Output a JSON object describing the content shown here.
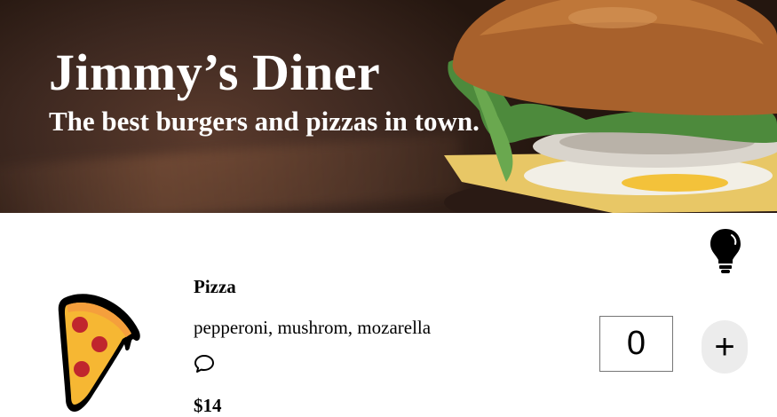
{
  "header": {
    "title": "Jimmy’s Diner",
    "subtitle": "The best burgers and pizzas in town."
  },
  "theme_toggle": {
    "icon": "lightbulb-icon"
  },
  "menu": [
    {
      "name": "Pizza",
      "ingredients": "pepperoni, mushrom, mozarella",
      "price": "$14",
      "quantity": "0",
      "add_label": "+",
      "icon": "pizza-icon",
      "comment_icon": "comment-icon"
    }
  ],
  "colors": {
    "background": "#ffffff",
    "text": "#000000",
    "add_button_bg": "#ececec"
  }
}
